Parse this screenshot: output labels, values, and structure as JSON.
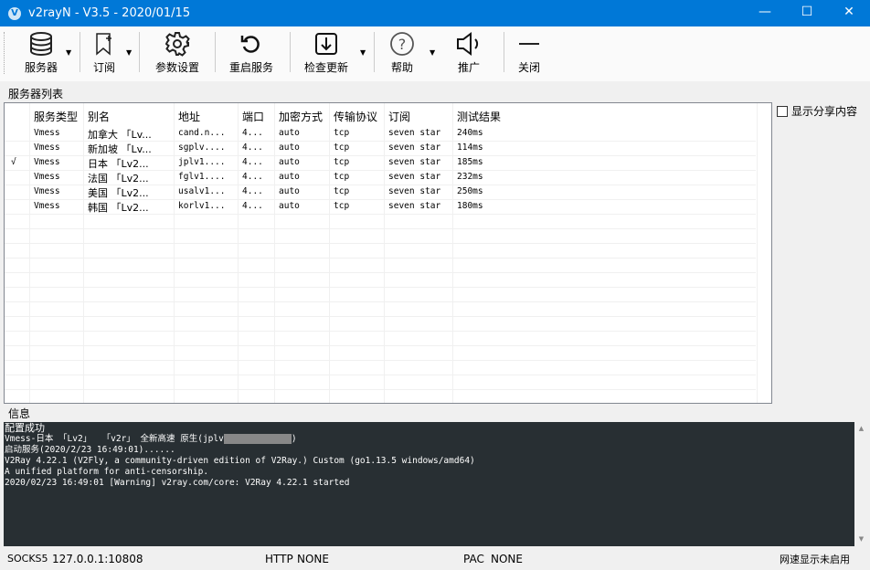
{
  "window": {
    "title": "v2rayN - V3.5 - 2020/01/15",
    "icon_letter": "V",
    "minimize": "—",
    "maximize": "☐",
    "close": "✕"
  },
  "toolbar": {
    "items": [
      {
        "label": "服务器",
        "icon": "database-icon",
        "dropdown": true
      },
      {
        "label": "订阅",
        "icon": "bookmark-add-icon",
        "dropdown": true
      },
      {
        "label": "参数设置",
        "icon": "gear-icon",
        "dropdown": false
      },
      {
        "label": "重启服务",
        "icon": "refresh-icon",
        "dropdown": false
      },
      {
        "label": "检查更新",
        "icon": "download-icon",
        "dropdown": true
      },
      {
        "label": "帮助",
        "icon": "help-icon",
        "dropdown": true
      },
      {
        "label": "推广",
        "icon": "speaker-icon",
        "dropdown": false
      },
      {
        "label": "关闭",
        "icon": "minus-icon",
        "dropdown": false
      }
    ]
  },
  "server_list": {
    "group_label": "服务器列表",
    "columns": [
      "",
      "服务类型",
      "别名",
      "地址",
      "端口",
      "加密方式",
      "传输协议",
      "订阅",
      "测试结果"
    ],
    "rows": [
      [
        "",
        "Vmess",
        "加拿大 「Lv...",
        "cand.n...",
        "4...",
        "auto",
        "tcp",
        "seven star",
        "240ms"
      ],
      [
        "",
        "Vmess",
        "新加坡 「Lv...",
        "sgplv....",
        "4...",
        "auto",
        "tcp",
        "seven star",
        "114ms"
      ],
      [
        "√",
        "Vmess",
        "日本 「Lv2...",
        "jplv1....",
        "4...",
        "auto",
        "tcp",
        "seven star",
        "185ms"
      ],
      [
        "",
        "Vmess",
        "法国 「Lv2...",
        "fglv1....",
        "4...",
        "auto",
        "tcp",
        "seven star",
        "232ms"
      ],
      [
        "",
        "Vmess",
        "美国 「Lv2...",
        "usalv1...",
        "4...",
        "auto",
        "tcp",
        "seven star",
        "250ms"
      ],
      [
        "",
        "Vmess",
        "韩国 「Lv2...",
        "korlv1...",
        "4...",
        "auto",
        "tcp",
        "seven star",
        "180ms"
      ]
    ]
  },
  "share_checkbox": {
    "label": "显示分享内容",
    "checked": false
  },
  "info": {
    "label": "信息",
    "lines": [
      "配置成功",
      "Vmess-日本 「Lv2」  「v2r」 全新高速 原生(jplv",
      "启动服务(2020/2/23 16:49:01)......",
      "V2Ray 4.22.1 (V2Fly, a community-driven edition of V2Ray.) Custom (go1.13.5 windows/amd64)",
      "A unified platform for anti-censorship.",
      "2020/02/23 16:49:01 [Warning] v2ray.com/core: V2Ray 4.22.1 started"
    ],
    "line2_suffix": ")"
  },
  "status": {
    "socks_label": "SOCKS5",
    "socks_value": "127.0.0.1:10808",
    "http_label": "HTTP",
    "http_value": "NONE",
    "pac_label": "PAC",
    "pac_value": "NONE",
    "speed": "网速显示未启用"
  },
  "colors": {
    "titlebar": "#0078d7",
    "log_bg": "#282f33"
  }
}
